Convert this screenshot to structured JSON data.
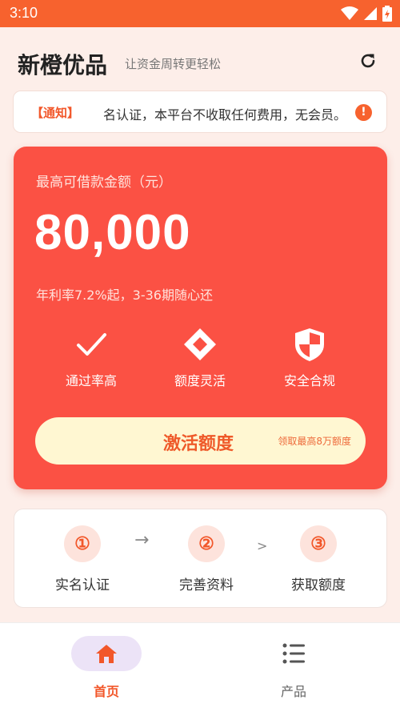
{
  "status_bar": {
    "time": "3:10"
  },
  "header": {
    "app_title": "新橙优品",
    "slogan": "让资金周转更轻松"
  },
  "notice": {
    "tag": "【通知】",
    "text": "名认证，本平台不收取任何费用，无会员。"
  },
  "loan_card": {
    "label": "最高可借款金额（元）",
    "amount": "80,000",
    "rate_text": "年利率7.2%起，3-36期随心还",
    "features": [
      {
        "label": "通过率高",
        "icon": "checkmark-icon"
      },
      {
        "label": "额度灵活",
        "icon": "diamond-icon"
      },
      {
        "label": "安全合规",
        "icon": "shield-icon"
      }
    ],
    "activate_button": {
      "label": "激活额度",
      "sublabel": "领取最高8万额度"
    }
  },
  "steps": {
    "items": [
      {
        "number": "①",
        "label": "实名认证"
      },
      {
        "number": "②",
        "label": "完善资料"
      },
      {
        "number": "③",
        "label": "获取额度"
      }
    ],
    "arrows": [
      "→",
      ">"
    ]
  },
  "tab_bar": {
    "tabs": [
      {
        "label": "首页",
        "icon": "home-icon",
        "active": true
      },
      {
        "label": "产品",
        "icon": "list-icon",
        "active": false
      }
    ]
  },
  "colors": {
    "primary": "#f7622e",
    "card": "#fb5144",
    "button_bg": "#fff7d2"
  }
}
